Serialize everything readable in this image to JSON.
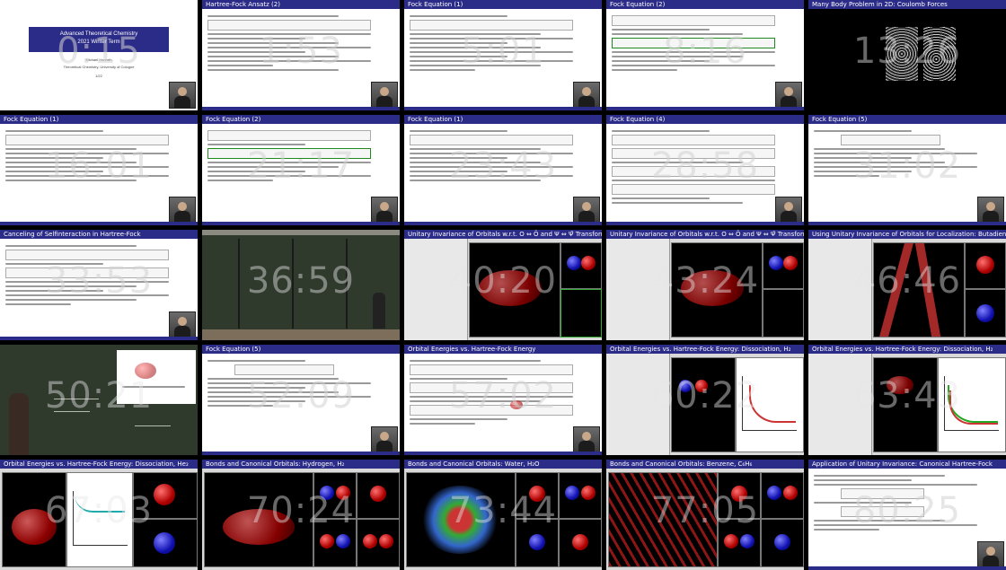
{
  "thumbnails": [
    {
      "title": "",
      "timecode": "0:15",
      "kind": "title",
      "slide_title": "Advanced Theoretical Chemistry",
      "slide_subtitle": "2021 Winter Term",
      "author": "Michael Hanrath",
      "affiliation": "Theoretical Chemistry, University of Cologne",
      "page": "1/22"
    },
    {
      "title": "Hartree-Fock Ansatz (2)",
      "timecode": "1:53",
      "kind": "slide"
    },
    {
      "title": "Fock Equation (1)",
      "timecode": "5:01",
      "kind": "slide"
    },
    {
      "title": "Fock Equation (2)",
      "timecode": "8:16",
      "kind": "slide"
    },
    {
      "title": "Many Body Problem in 2D: Coulomb Forces",
      "timecode": "13:26",
      "kind": "dark"
    },
    {
      "title": "Fock Equation (1)",
      "timecode": "16:01",
      "kind": "slide"
    },
    {
      "title": "Fock Equation (2)",
      "timecode": "21:17",
      "kind": "slide"
    },
    {
      "title": "Fock Equation (1)",
      "timecode": "23:43",
      "kind": "slide"
    },
    {
      "title": "Fock Equation (4)",
      "timecode": "28:58",
      "kind": "slide"
    },
    {
      "title": "Fock Equation (5)",
      "timecode": "31:02",
      "kind": "slide"
    },
    {
      "title": "Canceling of Selfinteraction in Hartree-Fock",
      "timecode": "33:53",
      "kind": "slide"
    },
    {
      "title": "",
      "timecode": "36:59",
      "kind": "board"
    },
    {
      "title": "Unitary Invariance of Orbitals w.r.t. O ⇔ Ō and Ψ ⇔ Ψ̄ Transformations",
      "timecode": "40:20",
      "kind": "sw"
    },
    {
      "title": "Unitary Invariance of Orbitals w.r.t. O ⇔ Ō and Ψ ⇔ Ψ̄ Transformations",
      "timecode": "43:24",
      "kind": "sw"
    },
    {
      "title": "Using Unitary Invariance of Orbitals for Localization: Butadiene, C₄H₆",
      "timecode": "46:46",
      "kind": "sw"
    },
    {
      "title": "",
      "timecode": "50:21",
      "kind": "board"
    },
    {
      "title": "Fock Equation (5)",
      "timecode": "52:09",
      "kind": "slide"
    },
    {
      "title": "Orbital Energies vs. Hartree-Fock Energy",
      "timecode": "57:02",
      "kind": "slide"
    },
    {
      "title": "Orbital Energies vs. Hartree-Fock Energy: Dissociation, H₂",
      "timecode": "60:22",
      "kind": "sw"
    },
    {
      "title": "Orbital Energies vs. Hartree-Fock Energy: Dissociation, H₂",
      "timecode": "63:43",
      "kind": "sw"
    },
    {
      "title": "Orbital Energies vs. Hartree-Fock Energy: Dissociation, He₂",
      "timecode": "67:03",
      "kind": "sw"
    },
    {
      "title": "Bonds and Canonical Orbitals: Hydrogen, H₂",
      "timecode": "70:24",
      "kind": "sw"
    },
    {
      "title": "Bonds and Canonical Orbitals: Water, H₂O",
      "timecode": "73:44",
      "kind": "sw"
    },
    {
      "title": "Bonds and Canonical Orbitals: Benzene, C₆H₆",
      "timecode": "77:05",
      "kind": "sw"
    },
    {
      "title": "Application of Unitary Invariance: Canonical Hartree-Fock",
      "timecode": "80:25",
      "kind": "slide"
    }
  ]
}
